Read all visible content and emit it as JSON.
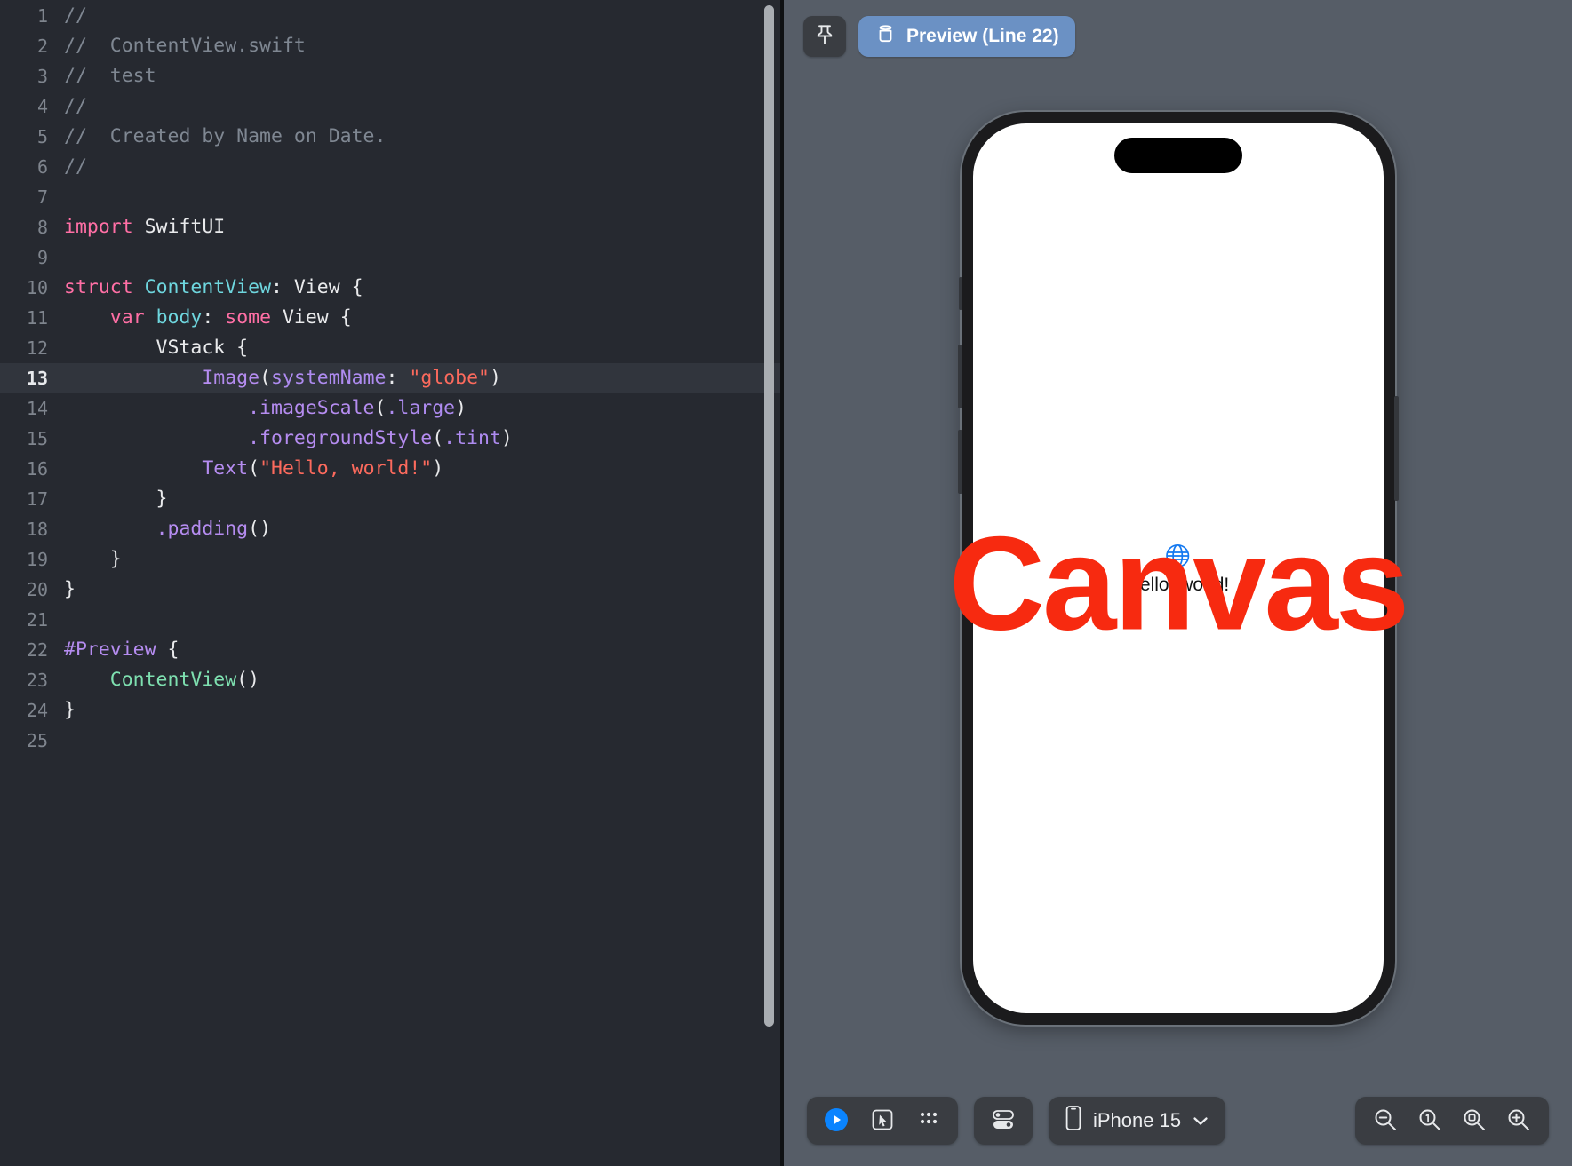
{
  "editor": {
    "language": "swift",
    "active_line": 13,
    "lines": [
      {
        "n": "1",
        "tokens": [
          {
            "t": "//",
            "c": "c-comment"
          }
        ]
      },
      {
        "n": "2",
        "tokens": [
          {
            "t": "//  ContentView.swift",
            "c": "c-comment"
          }
        ]
      },
      {
        "n": "3",
        "tokens": [
          {
            "t": "//  test",
            "c": "c-comment"
          }
        ]
      },
      {
        "n": "4",
        "tokens": [
          {
            "t": "//",
            "c": "c-comment"
          }
        ]
      },
      {
        "n": "5",
        "tokens": [
          {
            "t": "//  Created by Name on Date.",
            "c": "c-comment"
          }
        ]
      },
      {
        "n": "6",
        "tokens": [
          {
            "t": "//",
            "c": "c-comment"
          }
        ]
      },
      {
        "n": "7",
        "tokens": []
      },
      {
        "n": "8",
        "tokens": [
          {
            "t": "import",
            "c": "c-kw"
          },
          {
            "t": " SwiftUI",
            "c": "c-plain"
          }
        ]
      },
      {
        "n": "9",
        "tokens": []
      },
      {
        "n": "10",
        "tokens": [
          {
            "t": "struct",
            "c": "c-kw"
          },
          {
            "t": " ",
            "c": "c-plain"
          },
          {
            "t": "ContentView",
            "c": "c-type"
          },
          {
            "t": ": ",
            "c": "c-plain"
          },
          {
            "t": "View",
            "c": "c-plain"
          },
          {
            "t": " {",
            "c": "c-plain"
          }
        ]
      },
      {
        "n": "11",
        "tokens": [
          {
            "t": "    ",
            "c": "c-plain"
          },
          {
            "t": "var",
            "c": "c-kw"
          },
          {
            "t": " ",
            "c": "c-plain"
          },
          {
            "t": "body",
            "c": "c-type"
          },
          {
            "t": ": ",
            "c": "c-plain"
          },
          {
            "t": "some",
            "c": "c-kw"
          },
          {
            "t": " View {",
            "c": "c-plain"
          }
        ]
      },
      {
        "n": "12",
        "tokens": [
          {
            "t": "        VStack {",
            "c": "c-plain"
          }
        ]
      },
      {
        "n": "13",
        "tokens": [
          {
            "t": "            ",
            "c": "c-plain"
          },
          {
            "t": "Image",
            "c": "c-fn"
          },
          {
            "t": "(",
            "c": "c-plain"
          },
          {
            "t": "systemName",
            "c": "c-param"
          },
          {
            "t": ": ",
            "c": "c-plain"
          },
          {
            "t": "\"globe\"",
            "c": "c-str"
          },
          {
            "t": ")",
            "c": "c-plain"
          }
        ]
      },
      {
        "n": "14",
        "tokens": [
          {
            "t": "                ",
            "c": "c-plain"
          },
          {
            "t": ".imageScale",
            "c": "c-fn"
          },
          {
            "t": "(",
            "c": "c-plain"
          },
          {
            "t": ".large",
            "c": "c-param"
          },
          {
            "t": ")",
            "c": "c-plain"
          }
        ]
      },
      {
        "n": "15",
        "tokens": [
          {
            "t": "                ",
            "c": "c-plain"
          },
          {
            "t": ".foregroundStyle",
            "c": "c-fn"
          },
          {
            "t": "(",
            "c": "c-plain"
          },
          {
            "t": ".tint",
            "c": "c-param"
          },
          {
            "t": ")",
            "c": "c-plain"
          }
        ]
      },
      {
        "n": "16",
        "tokens": [
          {
            "t": "            ",
            "c": "c-plain"
          },
          {
            "t": "Text",
            "c": "c-fn"
          },
          {
            "t": "(",
            "c": "c-plain"
          },
          {
            "t": "\"Hello, world!\"",
            "c": "c-str"
          },
          {
            "t": ")",
            "c": "c-plain"
          }
        ]
      },
      {
        "n": "17",
        "tokens": [
          {
            "t": "        }",
            "c": "c-plain"
          }
        ]
      },
      {
        "n": "18",
        "tokens": [
          {
            "t": "        ",
            "c": "c-plain"
          },
          {
            "t": ".padding",
            "c": "c-fn"
          },
          {
            "t": "()",
            "c": "c-plain"
          }
        ]
      },
      {
        "n": "19",
        "tokens": [
          {
            "t": "    }",
            "c": "c-plain"
          }
        ]
      },
      {
        "n": "20",
        "tokens": [
          {
            "t": "}",
            "c": "c-plain"
          }
        ]
      },
      {
        "n": "21",
        "tokens": []
      },
      {
        "n": "22",
        "tokens": [
          {
            "t": "#Preview",
            "c": "c-macro"
          },
          {
            "t": " {",
            "c": "c-plain"
          }
        ]
      },
      {
        "n": "23",
        "tokens": [
          {
            "t": "    ",
            "c": "c-plain"
          },
          {
            "t": "ContentView",
            "c": "c-green"
          },
          {
            "t": "()",
            "c": "c-plain"
          }
        ]
      },
      {
        "n": "24",
        "tokens": [
          {
            "t": "}",
            "c": "c-plain"
          }
        ]
      },
      {
        "n": "25",
        "tokens": []
      }
    ]
  },
  "canvas": {
    "top_toolbar": {
      "pin_label": "pin",
      "preview_chip_label": "Preview (Line 22)"
    },
    "watermark": "Canvas",
    "preview": {
      "image_symbol": "globe",
      "text_label": "Hello, world!"
    },
    "bottom_toolbar": {
      "play_label": "play",
      "select_label": "select",
      "variants_label": "variants",
      "device_settings_label": "device settings",
      "device_name": "iPhone 15",
      "zoom_out_label": "zoom out",
      "zoom_actual_label": "zoom 1x",
      "zoom_fit_label": "zoom to fit",
      "zoom_in_label": "zoom in"
    }
  },
  "colors": {
    "editor_bg": "#262930",
    "active_line_bg": "#31353d",
    "canvas_bg": "#565d67",
    "accent_blue": "#6b91c4",
    "play_blue": "#0a84ff",
    "watermark_red": "#f72a10",
    "toolbar_bg": "#3a3d42"
  }
}
